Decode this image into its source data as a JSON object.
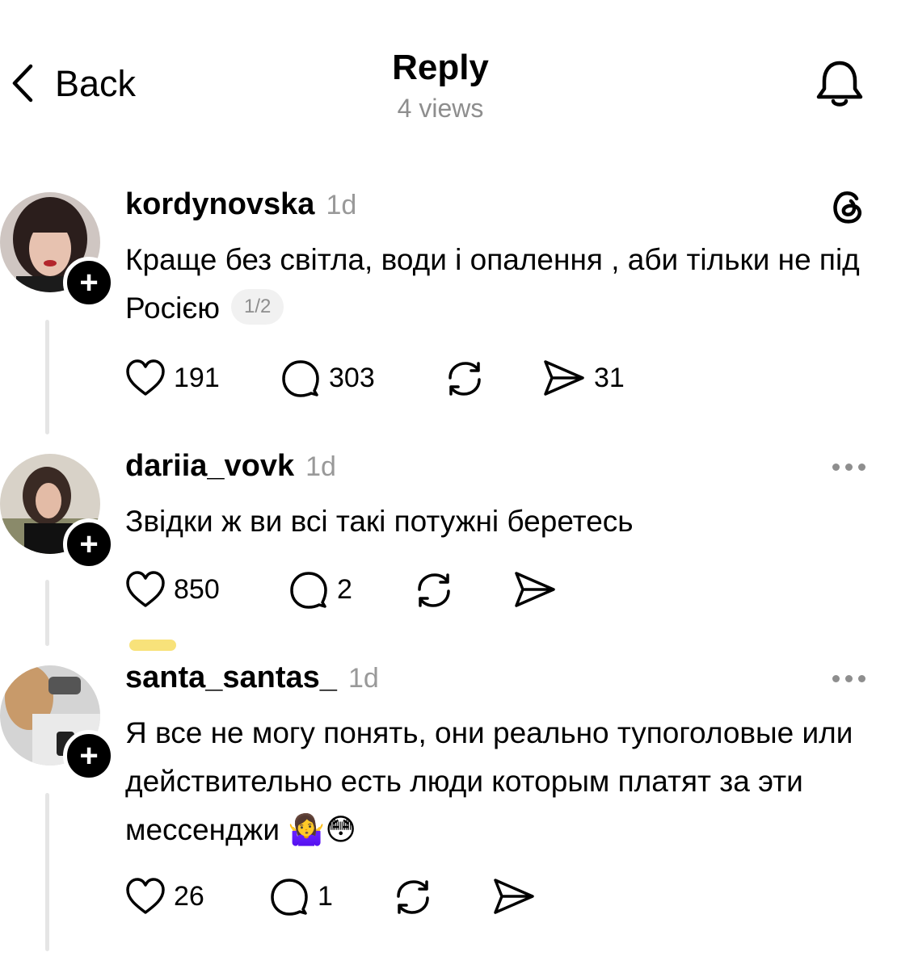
{
  "header": {
    "back_label": "Back",
    "title": "Reply",
    "views": "4 views"
  },
  "posts": [
    {
      "username": "kordynovska",
      "time": "1d",
      "text": "Краще без світла, води і опалення , аби тільки не під Росією",
      "pager": "1/2",
      "likes": "191",
      "replies": "303",
      "reposts": "",
      "shares": "31"
    },
    {
      "username": "dariia_vovk",
      "time": "1d",
      "text": "Звідки ж ви всі такі потужні беретесь",
      "likes": "850",
      "replies": "2",
      "reposts": "",
      "shares": ""
    },
    {
      "username": "santa_santas_",
      "time": "1d",
      "text": "Я все не могу понять, они реально тупоголовые или действительно есть люди которым платят за эти мессенджи 🤷‍♀️😳",
      "likes": "26",
      "replies": "1",
      "reposts": "",
      "shares": ""
    }
  ],
  "icons": {
    "back": "chevron-left-icon",
    "notification": "bell-icon",
    "threads": "threads-logo-icon",
    "like": "heart-icon",
    "reply": "comment-icon",
    "repost": "repost-icon",
    "share": "send-icon",
    "more": "more-dots-icon"
  },
  "colors": {
    "text": "#000000",
    "secondary": "#8e8e8e",
    "thread_line": "#e5e5e5",
    "highlight": "#f8e27a"
  }
}
